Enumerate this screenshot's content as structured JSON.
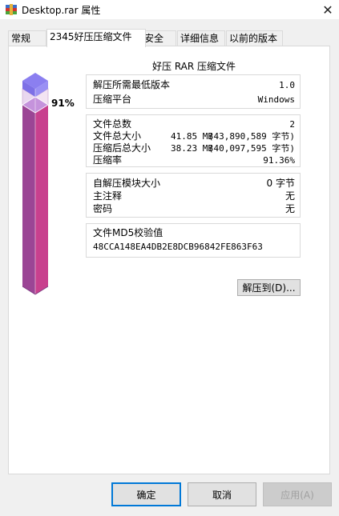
{
  "window": {
    "title": "Desktop.rar 属性",
    "close_glyph": "✕"
  },
  "tabs": [
    {
      "label": "常规"
    },
    {
      "label": "2345好压压缩文件"
    },
    {
      "label": "安全"
    },
    {
      "label": "详细信息"
    },
    {
      "label": "以前的版本"
    }
  ],
  "archive": {
    "heading": "好压 RAR 压缩文件",
    "ratio_percent": "91%",
    "fill_fraction": 0.91,
    "version_group": [
      {
        "label": "解压所需最低版本",
        "value": "1.0"
      },
      {
        "label": "压缩平台",
        "value": "Windows"
      }
    ],
    "size_group": {
      "file_count": {
        "label": "文件总数",
        "value": "2"
      },
      "total_size": {
        "label": "文件总大小",
        "mb": "41.85 MB",
        "bytes": "(43,890,589 字节)"
      },
      "packed_size": {
        "label": "压缩后总大小",
        "mb": "38.23 MB",
        "bytes": "(40,097,595 字节)"
      },
      "ratio": {
        "label": "压缩率",
        "value": "91.36%"
      }
    },
    "extra_group": [
      {
        "label": "自解压模块大小",
        "value": "0 字节"
      },
      {
        "label": "主注释",
        "value": "无"
      },
      {
        "label": "密码",
        "value": "无"
      }
    ],
    "md5": {
      "label": "文件MD5校验值",
      "value": "48CCA148EA4DB2E8DCB96842FE863F63"
    },
    "extract_button": "解压到(D)..."
  },
  "footer": {
    "ok": "确定",
    "cancel": "取消",
    "apply": "应用(A)"
  },
  "colors": {
    "bar_pink": "#c8408e",
    "bar_purple": "#8e4a9c",
    "bar_top": "#8b7ff0",
    "focus_blue": "#0078d7"
  }
}
